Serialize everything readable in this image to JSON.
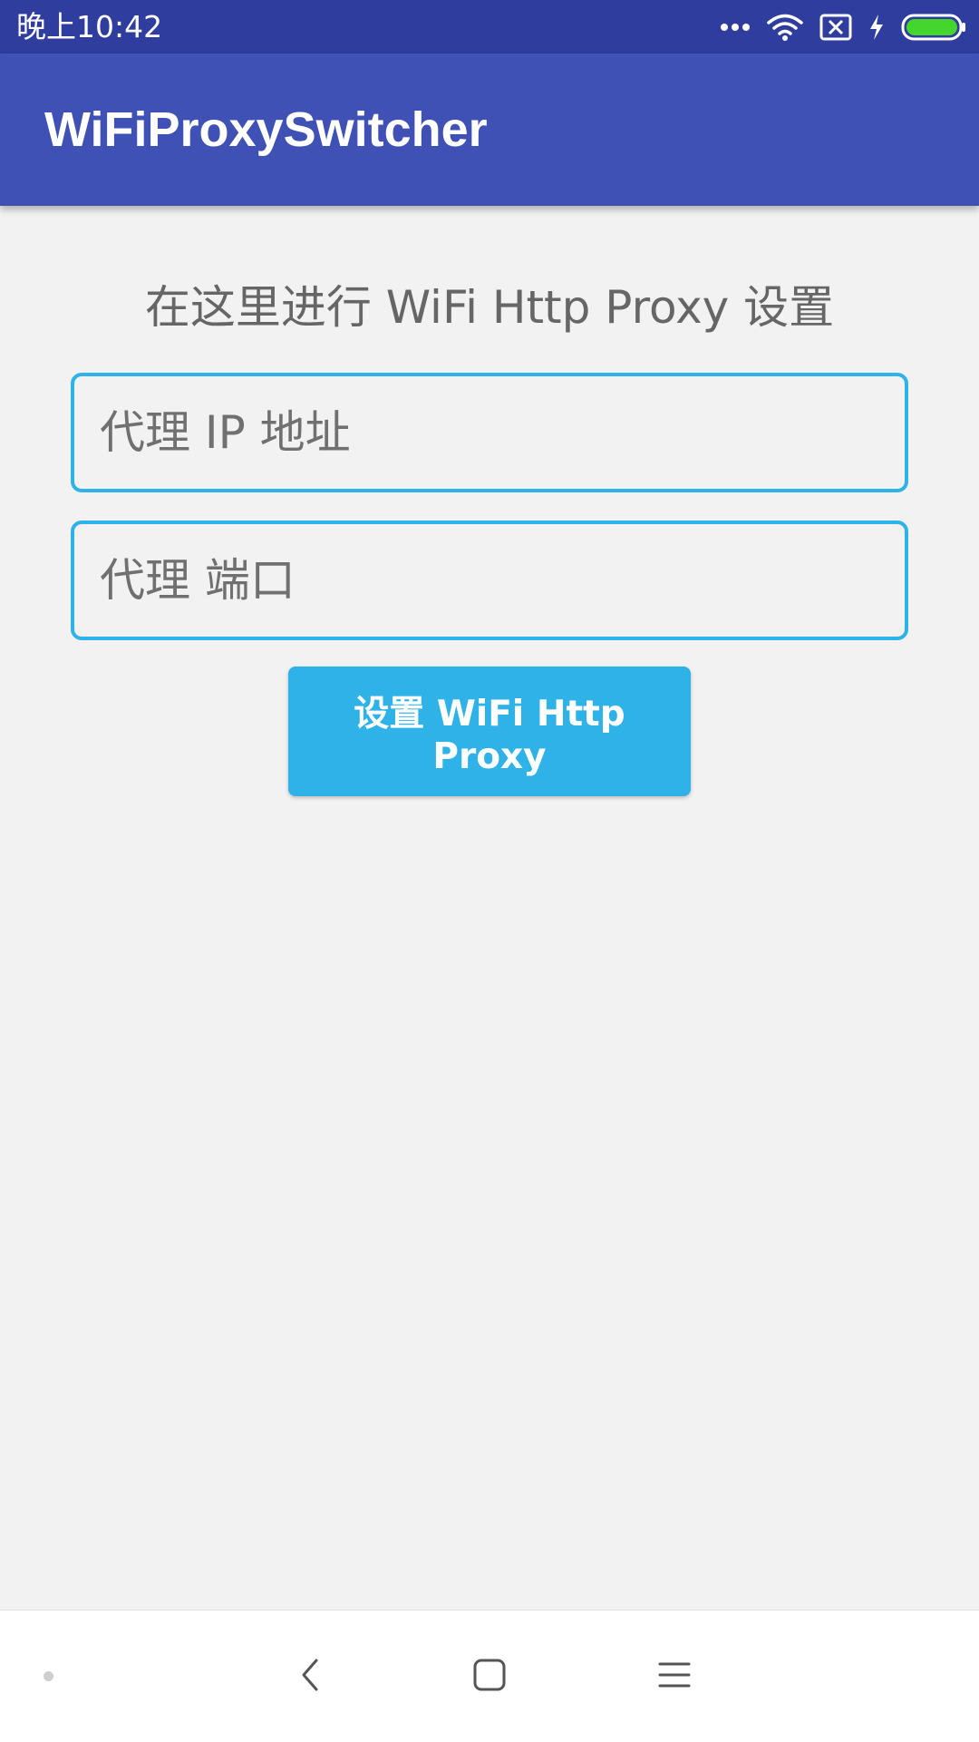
{
  "status_bar": {
    "time": "晚上10:42",
    "icons": [
      "more-dots-icon",
      "wifi-icon",
      "no-sim-icon",
      "charging-icon",
      "battery-icon"
    ],
    "battery_color": "#44d62c"
  },
  "app_bar": {
    "title": "WiFiProxySwitcher",
    "color": "#3f51b5"
  },
  "main": {
    "heading": "在这里进行 WiFi Http Proxy 设置",
    "ip_field": {
      "placeholder": "代理 IP 地址",
      "value": ""
    },
    "port_field": {
      "placeholder": "代理 端口",
      "value": ""
    },
    "submit_label": "设置 WiFi Http Proxy",
    "accent_color": "#2fb2e8"
  },
  "nav_bar": {
    "icons": [
      "back-icon",
      "home-icon",
      "menu-icon"
    ]
  }
}
